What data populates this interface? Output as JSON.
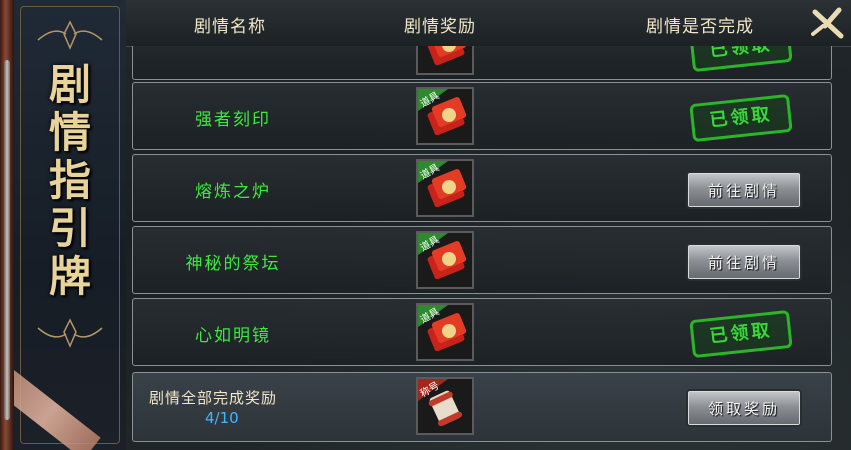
{
  "banner": {
    "title_chars": [
      "剧",
      "情",
      "指",
      "引",
      "牌"
    ]
  },
  "header": {
    "col_name": "剧情名称",
    "col_reward": "剧情奖励",
    "col_status": "剧情是否完成"
  },
  "rows": [
    {
      "name": "",
      "reward_tag": "",
      "status": "已领取",
      "status_type": "claimed"
    },
    {
      "name": "强者刻印",
      "reward_tag": "道具",
      "status": "已领取",
      "status_type": "claimed"
    },
    {
      "name": "熔炼之炉",
      "reward_tag": "道具",
      "status": "前往剧情",
      "status_type": "button"
    },
    {
      "name": "神秘的祭坛",
      "reward_tag": "道具",
      "status": "前往剧情",
      "status_type": "button"
    },
    {
      "name": "心如明镜",
      "reward_tag": "道具",
      "status": "已领取",
      "status_type": "claimed"
    }
  ],
  "final": {
    "title": "剧情全部完成奖励",
    "progress": "4/10",
    "reward_tag": "称号",
    "button": "领取奖励"
  },
  "colors": {
    "name_green": "#3fe83f",
    "claimed_green": "#38d838",
    "header_text": "#f1e7c8",
    "progress_blue": "#3fb8ff"
  }
}
